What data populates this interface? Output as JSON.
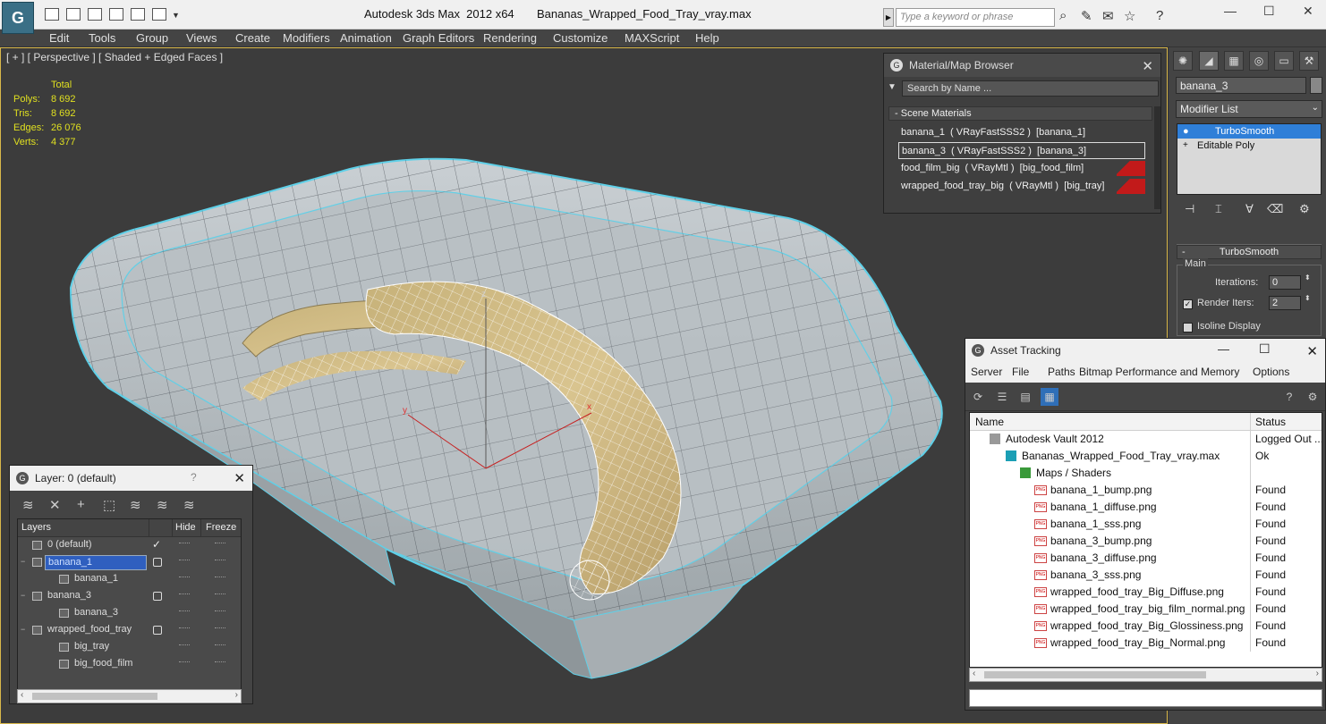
{
  "titlebar": {
    "title": "Autodesk 3ds Max  2012 x64       Bananas_Wrapped_Food_Tray_vray.max",
    "search_placeholder": "Type a keyword or phrase"
  },
  "menu": [
    "Edit",
    "Tools",
    "Group",
    "Views",
    "Create",
    "Modifiers",
    "Animation",
    "Graph Editors",
    "Rendering",
    "Customize",
    "MAXScript",
    "Help"
  ],
  "viewport": {
    "label": "[ + ] [ Perspective ] [ Shaded + Edged Faces ]",
    "stats_header": "Total",
    "stats": [
      {
        "label": "Polys:",
        "value": "8 692"
      },
      {
        "label": "Tris:",
        "value": "8 692"
      },
      {
        "label": "Edges:",
        "value": "26 076"
      },
      {
        "label": "Verts:",
        "value": "4 377"
      }
    ],
    "axis_labels": {
      "x": "x",
      "y": "y",
      "z": "z"
    }
  },
  "command_panel": {
    "object_name": "banana_3",
    "modifier_list": "Modifier List",
    "stack": [
      "TurboSmooth",
      "Editable Poly"
    ],
    "rollout_title": "TurboSmooth",
    "group_title": "Main",
    "iterations_label": "Iterations:",
    "iterations_value": "0",
    "render_iters_label": "Render Iters:",
    "render_iters_value": "2",
    "isoline_label": "Isoline Display"
  },
  "material_browser": {
    "title": "Material/Map Browser",
    "search_placeholder": "Search by Name ...",
    "section": "Scene Materials",
    "items": [
      "banana_1  ( VRayFastSSS2 )  [banana_1]",
      "banana_3  ( VRayFastSSS2 )  [banana_3]",
      "food_film_big  ( VRayMtl )  [big_food_film]",
      "wrapped_food_tray_big  ( VRayMtl )  [big_tray]"
    ]
  },
  "asset_tracking": {
    "title": "Asset Tracking",
    "menu": [
      "Server",
      "File",
      "Paths",
      "Bitmap Performance and Memory",
      "Options"
    ],
    "col_name": "Name",
    "col_status": "Status",
    "rows": [
      {
        "name": "Autodesk Vault 2012",
        "status": "Logged Out ..."
      },
      {
        "name": "Bananas_Wrapped_Food_Tray_vray.max",
        "status": "Ok"
      },
      {
        "name": "Maps / Shaders",
        "status": ""
      },
      {
        "name": "banana_1_bump.png",
        "status": "Found"
      },
      {
        "name": "banana_1_diffuse.png",
        "status": "Found"
      },
      {
        "name": "banana_1_sss.png",
        "status": "Found"
      },
      {
        "name": "banana_3_bump.png",
        "status": "Found"
      },
      {
        "name": "banana_3_diffuse.png",
        "status": "Found"
      },
      {
        "name": "banana_3_sss.png",
        "status": "Found"
      },
      {
        "name": "wrapped_food_tray_Big_Diffuse.png",
        "status": "Found"
      },
      {
        "name": "wrapped_food_tray_big_film_normal.png",
        "status": "Found"
      },
      {
        "name": "wrapped_food_tray_Big_Glossiness.png",
        "status": "Found"
      },
      {
        "name": "wrapped_food_tray_Big_Normal.png",
        "status": "Found"
      }
    ]
  },
  "layer_manager": {
    "title": "Layer: 0 (default)",
    "help": "?",
    "col_layers": "Layers",
    "col_hide": "Hide",
    "col_freeze": "Freeze",
    "rows": [
      {
        "name": "0 (default)"
      },
      {
        "name": "banana_1"
      },
      {
        "name": "banana_1"
      },
      {
        "name": "banana_3"
      },
      {
        "name": "banana_3"
      },
      {
        "name": "wrapped_food_tray"
      },
      {
        "name": "big_tray"
      },
      {
        "name": "big_food_film"
      }
    ]
  }
}
